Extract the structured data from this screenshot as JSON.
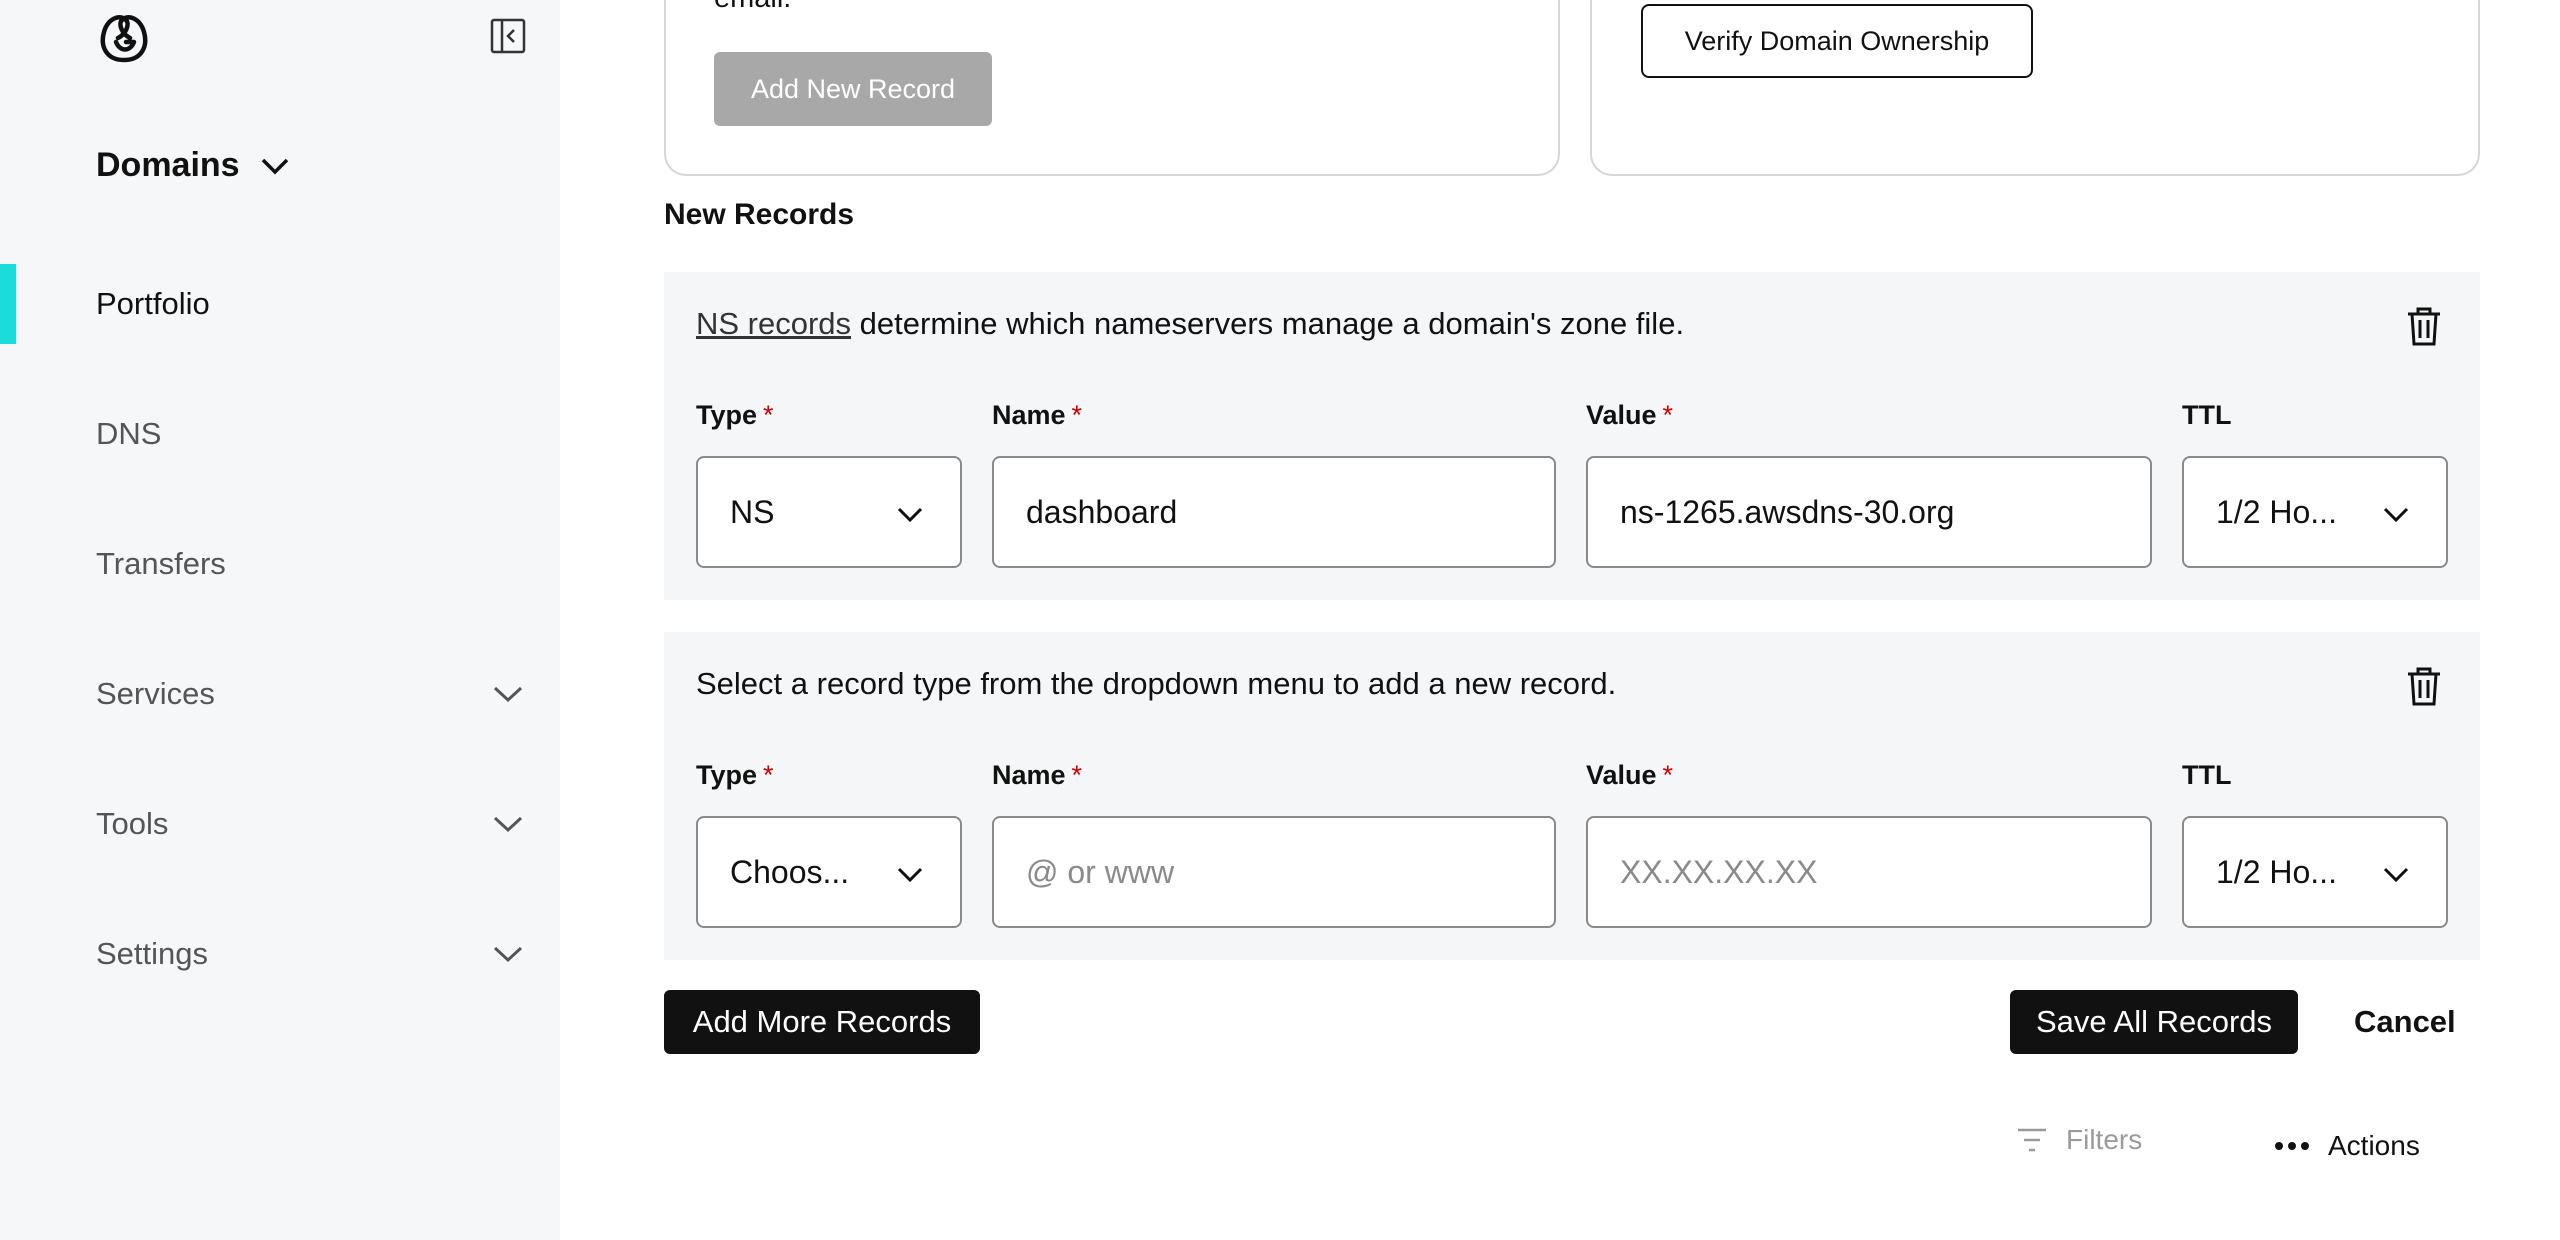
{
  "sidebar": {
    "section_title": "Domains",
    "items": [
      {
        "label": "Portfolio"
      },
      {
        "label": "DNS"
      },
      {
        "label": "Transfers"
      },
      {
        "label": "Services"
      },
      {
        "label": "Tools"
      },
      {
        "label": "Settings"
      }
    ]
  },
  "top_cards": {
    "left_clipped_text": "email.",
    "add_new_record": "Add New Record",
    "verify_domain": "Verify Domain Ownership"
  },
  "new_records": {
    "title": "New Records",
    "labels": {
      "type": "Type",
      "name": "Name",
      "value": "Value",
      "ttl": "TTL",
      "required": "*"
    },
    "records": [
      {
        "desc_link": "NS records",
        "desc_rest": " determine which nameservers manage a domain's zone file.",
        "type": "NS",
        "name": "dashboard",
        "value": "ns-1265.awsdns-30.org",
        "ttl": "1/2 Ho..."
      },
      {
        "desc_link": "",
        "desc_rest": "Select a record type from the dropdown menu to add a new record.",
        "type": "Choos...",
        "name_placeholder": "@ or www",
        "value_placeholder": "XX.XX.XX.XX",
        "ttl": "1/2 Ho..."
      }
    ]
  },
  "actions": {
    "add_more": "Add More Records",
    "save_all": "Save All Records",
    "cancel": "Cancel"
  },
  "toolbar": {
    "filters": "Filters",
    "actions": "Actions"
  },
  "colors": {
    "accent": "#1bdbdb",
    "primary_button": "#111111",
    "disabled_button": "#a8a8a8",
    "required": "#d10000"
  }
}
